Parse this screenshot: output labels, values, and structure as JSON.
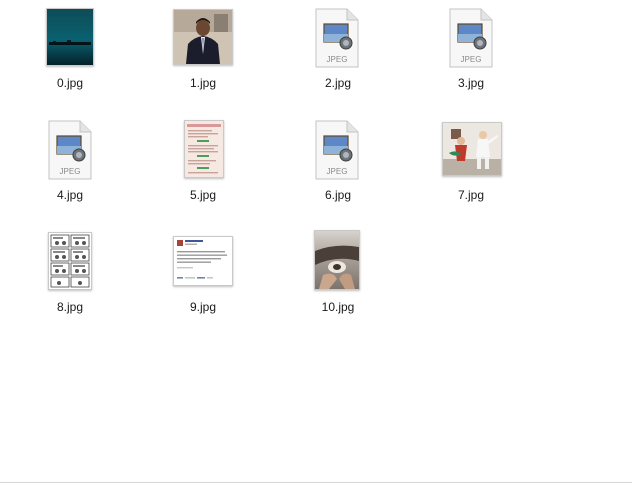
{
  "files": [
    {
      "name": "0.jpg",
      "kind": "thumbnail",
      "icon": "teal-landscape-thumbnail"
    },
    {
      "name": "1.jpg",
      "kind": "thumbnail",
      "icon": "man-portrait-thumbnail"
    },
    {
      "name": "2.jpg",
      "kind": "generic",
      "icon": "jpeg-file-icon",
      "badge": "JPEG"
    },
    {
      "name": "3.jpg",
      "kind": "generic",
      "icon": "jpeg-file-icon",
      "badge": "JPEG"
    },
    {
      "name": "4.jpg",
      "kind": "generic",
      "icon": "jpeg-file-icon",
      "badge": "JPEG"
    },
    {
      "name": "5.jpg",
      "kind": "thumbnail",
      "icon": "webpage-screenshot-thumbnail"
    },
    {
      "name": "6.jpg",
      "kind": "generic",
      "icon": "jpeg-file-icon",
      "badge": "JPEG"
    },
    {
      "name": "7.jpg",
      "kind": "thumbnail",
      "icon": "costume-photo-thumbnail"
    },
    {
      "name": "8.jpg",
      "kind": "thumbnail",
      "icon": "comic-strip-thumbnail"
    },
    {
      "name": "9.jpg",
      "kind": "thumbnail",
      "icon": "social-post-thumbnail"
    },
    {
      "name": "10.jpg",
      "kind": "thumbnail",
      "icon": "handheld-photo-thumbnail"
    }
  ]
}
